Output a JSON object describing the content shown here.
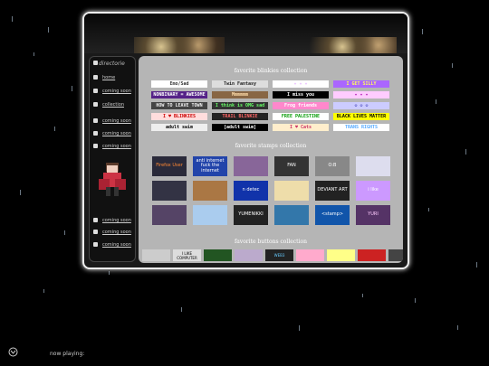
{
  "sidebar": {
    "title": "directorie",
    "items": [
      {
        "label": "home"
      },
      {
        "label": "coming soon"
      },
      {
        "label": "collection"
      },
      {
        "label": "coming soon"
      },
      {
        "label": "coming soon"
      },
      {
        "label": "coming soon"
      },
      {
        "label": "coming soon"
      },
      {
        "label": "coming soon"
      },
      {
        "label": "coming soon"
      }
    ]
  },
  "main": {
    "blinkies_title": "favorite blinkies collection",
    "stamps_title": "favorite stamps collection",
    "buttons_title": "favorite buttons collection",
    "blinkies": [
      {
        "text": "Emo/Sad",
        "bg": "#ffffff",
        "fg": "#333333"
      },
      {
        "text": "Twin Fantasy",
        "bg": "#dddddd",
        "fg": "#222222"
      },
      {
        "text": "✧ ✧ ✧",
        "bg": "#ffffff",
        "fg": "#cc66ff"
      },
      {
        "text": "I GET SILLY",
        "bg": "#aa66ff",
        "fg": "#ffff55"
      },
      {
        "text": "NONBINARY = AWESOME",
        "bg": "#552288",
        "fg": "#ffffff"
      },
      {
        "text": "Mmmmmm",
        "bg": "#886644",
        "fg": "#ffddaa"
      },
      {
        "text": "I miss you",
        "bg": "#000000",
        "fg": "#ffffff"
      },
      {
        "text": "✦ ✦ ✦",
        "bg": "#ffccff",
        "fg": "#aa00aa"
      },
      {
        "text": "HOW TO LEAVE TOWN",
        "bg": "#444444",
        "fg": "#eeeeee"
      },
      {
        "text": "I think is OMG sad",
        "bg": "#333333",
        "fg": "#66ff66"
      },
      {
        "text": "Frog friends",
        "bg": "#ff88cc",
        "fg": "#ffffff"
      },
      {
        "text": "✿ ✿ ✿",
        "bg": "#ccccff",
        "fg": "#6666cc"
      },
      {
        "text": "I ♥ BLINKIES",
        "bg": "#ffdddd",
        "fg": "#cc0000"
      },
      {
        "text": "TRAIL BLINKIE",
        "bg": "#222222",
        "fg": "#ff6666"
      },
      {
        "text": "FREE PALESTINE",
        "bg": "#ffffff",
        "fg": "#009900"
      },
      {
        "text": "BLACK LIVES MATTER",
        "bg": "#ffff00",
        "fg": "#000000"
      },
      {
        "text": "adult swim",
        "bg": "#eeeeee",
        "fg": "#000000"
      },
      {
        "text": "[adult swim]",
        "bg": "#000000",
        "fg": "#ffffff"
      },
      {
        "text": "I ♥ Cats",
        "bg": "#ffeecc",
        "fg": "#cc3366"
      },
      {
        "text": "TRANS RIGHTS",
        "bg": "#ffffff",
        "fg": "#55aaff"
      }
    ],
    "stamps": [
      {
        "text": "Firefox User",
        "bg": "#2a2a3a",
        "fg": "#ff8833"
      },
      {
        "text": "anti internet fuck the internet",
        "bg": "#2244aa",
        "fg": "#ffffff"
      },
      {
        "text": "",
        "bg": "#886699",
        "fg": "#ffffff"
      },
      {
        "text": "FAN",
        "bg": "#333333",
        "fg": "#ffffff"
      },
      {
        "text": "O:B",
        "bg": "#888888",
        "fg": "#ffffff"
      },
      {
        "text": "",
        "bg": "#ddddee",
        "fg": "#222222"
      },
      {
        "text": "",
        "bg": "#333344",
        "fg": "#eeeeee"
      },
      {
        "text": "",
        "bg": "#aa7744",
        "fg": "#ffffff"
      },
      {
        "text": "n detec",
        "bg": "#1133aa",
        "fg": "#ffffff"
      },
      {
        "text": "",
        "bg": "#eeddaa",
        "fg": "#333333"
      },
      {
        "text": "DEVIANT ART",
        "bg": "#222222",
        "fg": "#ffffff"
      },
      {
        "text": "i like",
        "bg": "#cc99ff",
        "fg": "#ffffff"
      },
      {
        "text": "",
        "bg": "#554466",
        "fg": "#ffffff"
      },
      {
        "text": "",
        "bg": "#aaccee",
        "fg": "#ffffff"
      },
      {
        "text": "YUMENIKKI",
        "bg": "#222222",
        "fg": "#ffffff"
      },
      {
        "text": "",
        "bg": "#3377aa",
        "fg": "#ffffff"
      },
      {
        "text": "<stamp>",
        "bg": "#1155aa",
        "fg": "#ffffff"
      },
      {
        "text": "YURI",
        "bg": "#553366",
        "fg": "#ffccff"
      }
    ],
    "buttons": [
      {
        "text": "",
        "bg": "#cccccc",
        "fg": "#000000"
      },
      {
        "text": "I LIKE COMPUTER",
        "bg": "#dddddd",
        "fg": "#000000"
      },
      {
        "text": "",
        "bg": "#225522",
        "fg": "#ffffff"
      },
      {
        "text": "",
        "bg": "#bbaacc",
        "fg": "#222222"
      },
      {
        "text": "WEB3",
        "bg": "#222222",
        "fg": "#66ccff"
      },
      {
        "text": "",
        "bg": "#ffaacc",
        "fg": "#222222"
      },
      {
        "text": "",
        "bg": "#ffff88",
        "fg": "#cc3366"
      },
      {
        "text": "",
        "bg": "#cc2222",
        "fg": "#ffffff"
      },
      {
        "text": "",
        "bg": "#444444",
        "fg": "#ffaa00"
      }
    ]
  },
  "footer": {
    "now_playing": "now playing:"
  }
}
